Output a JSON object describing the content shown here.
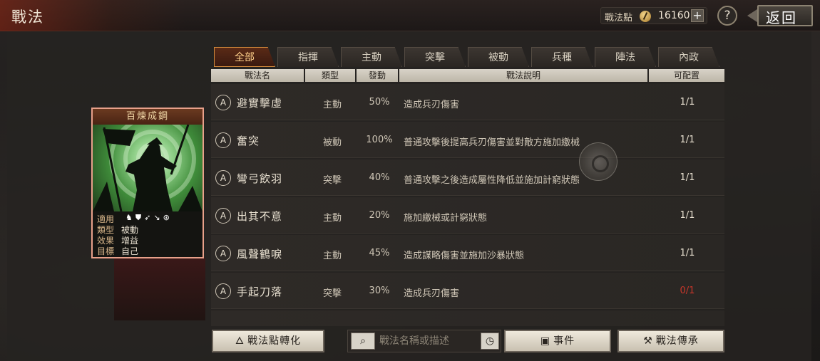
{
  "header": {
    "title": "戰法",
    "points_label": "戰法點",
    "points_value": "16160",
    "add_label": "+",
    "help_label": "?",
    "back_label": "返回"
  },
  "tabs": [
    {
      "label": "全部",
      "active": true
    },
    {
      "label": "指揮",
      "active": false
    },
    {
      "label": "主動",
      "active": false
    },
    {
      "label": "突擊",
      "active": false
    },
    {
      "label": "被動",
      "active": false
    },
    {
      "label": "兵種",
      "active": false
    },
    {
      "label": "陣法",
      "active": false
    },
    {
      "label": "內政",
      "active": false
    }
  ],
  "columns": {
    "name": "戰法名",
    "type": "類型",
    "rate": "發動",
    "desc": "戰法說明",
    "slots": "可配置"
  },
  "rows": [
    {
      "grade": "A",
      "name": "避實擊虛",
      "type": "主動",
      "rate": "50%",
      "desc": "造成兵刃傷害",
      "slots": "1/1",
      "slots_red": false
    },
    {
      "grade": "A",
      "name": "奮突",
      "type": "被動",
      "rate": "100%",
      "desc": "普通攻擊後提高兵刃傷害並對敵方施加繳械",
      "slots": "1/1",
      "slots_red": false
    },
    {
      "grade": "A",
      "name": "彎弓飲羽",
      "type": "突擊",
      "rate": "40%",
      "desc": "普通攻擊之後造成屬性降低並施加計窮狀態",
      "slots": "1/1",
      "slots_red": false
    },
    {
      "grade": "A",
      "name": "出其不意",
      "type": "主動",
      "rate": "20%",
      "desc": "施加繳械或計窮狀態",
      "slots": "1/1",
      "slots_red": false
    },
    {
      "grade": "A",
      "name": "風聲鶴唳",
      "type": "主動",
      "rate": "45%",
      "desc": "造成謀略傷害並施加沙暴狀態",
      "slots": "1/1",
      "slots_red": false
    },
    {
      "grade": "A",
      "name": "手起刀落",
      "type": "突擊",
      "rate": "30%",
      "desc": "造成兵刃傷害",
      "slots": "0/1",
      "slots_red": true
    }
  ],
  "card": {
    "title": "百煉成鋼",
    "apply_key": "適用",
    "type_key": "類型",
    "type_value": "被動",
    "effect_key": "效果",
    "effect_value": "增益",
    "target_key": "目標",
    "target_value": "自己",
    "unit_icons": [
      "cavalry-icon",
      "shield-icon",
      "archer-icon",
      "spear-icon",
      "siege-icon"
    ]
  },
  "bottom": {
    "convert_label": "戰法點轉化",
    "search_placeholder": "戰法名稱或描述",
    "event_label": "事件",
    "inherit_label": "戰法傳承"
  },
  "colors": {
    "accent": "#d38a3c",
    "active_tab_text": "#ffd08a",
    "warning": "#c8362a"
  }
}
